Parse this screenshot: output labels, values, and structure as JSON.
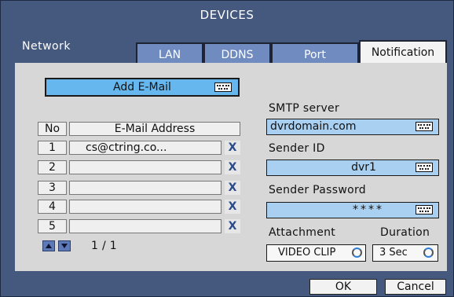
{
  "window": {
    "title": "DEVICES"
  },
  "section": {
    "label": "Network"
  },
  "tabs": [
    {
      "label": "LAN"
    },
    {
      "label": "DDNS"
    },
    {
      "label": "Port"
    },
    {
      "label": "Notification",
      "active": true
    }
  ],
  "email": {
    "add_label": "Add E-Mail",
    "columns": {
      "no": "No",
      "address": "E-Mail Address"
    },
    "rows": [
      {
        "no": "1",
        "address": "cs@ctring.co..."
      },
      {
        "no": "2",
        "address": ""
      },
      {
        "no": "3",
        "address": ""
      },
      {
        "no": "4",
        "address": ""
      },
      {
        "no": "5",
        "address": ""
      }
    ],
    "remove_glyph": "X",
    "page": "1 / 1"
  },
  "smtp": {
    "server_label": "SMTP server",
    "server_value": "dvrdomain.com",
    "sender_id_label": "Sender ID",
    "sender_id_value": "dvr1",
    "password_label": "Sender Password",
    "password_value": "****"
  },
  "attachment": {
    "label": "Attachment",
    "value": "VIDEO CLIP"
  },
  "duration": {
    "label": "Duration",
    "value": "3 Sec"
  },
  "footer": {
    "ok": "OK",
    "cancel": "Cancel"
  },
  "icons": {
    "keyboard": "keyboard-icon",
    "cycle": "cycle-icon",
    "up": "arrow-up-icon",
    "down": "arrow-down-icon"
  },
  "colors": {
    "window_bg": "#45587e",
    "panel_bg": "#d7d7d7",
    "tab_bg": "#6f8bbf",
    "add_button": "#66b7ee",
    "field_bg": "#a9cff1"
  }
}
